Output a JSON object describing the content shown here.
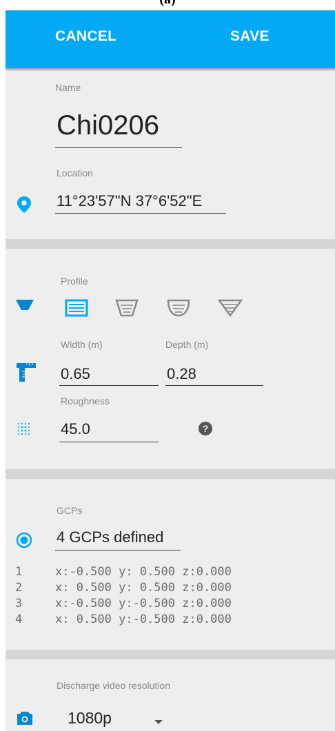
{
  "caption": "(a)",
  "toolbar": {
    "cancel_label": "CANCEL",
    "save_label": "SAVE"
  },
  "site": {
    "name_label": "Name",
    "name_value": "Chi0206",
    "location_label": "Location",
    "location_value": "11°23'57\"N 37°6'52\"E"
  },
  "profile": {
    "label": "Profile",
    "options": [
      "rectangular",
      "trapezoid",
      "rounded",
      "v-shape"
    ],
    "selected": "rectangular",
    "width_label": "Width (m)",
    "width_value": "0.65",
    "depth_label": "Depth (m)",
    "depth_value": "0.28",
    "roughness_label": "Roughness",
    "roughness_value": "45.0"
  },
  "gcps": {
    "label": "GCPs",
    "summary": "4 GCPs defined",
    "rows": [
      {
        "index": "1",
        "coords": "x:-0.500 y: 0.500 z:0.000"
      },
      {
        "index": "2",
        "coords": "x: 0.500 y: 0.500 z:0.000"
      },
      {
        "index": "3",
        "coords": "x:-0.500 y:-0.500 z:0.000"
      },
      {
        "index": "4",
        "coords": "x: 0.500 y:-0.500 z:0.000"
      }
    ]
  },
  "video": {
    "label": "Discharge video resolution",
    "selected": "1080p"
  },
  "colors": {
    "accent": "#03a9f4",
    "card": "#eeeeee",
    "separator": "#d6d6d6"
  },
  "icons": [
    "location-pin-icon",
    "profile-channel-icon",
    "ruler-icon",
    "roughness-dots-icon",
    "help-icon",
    "radio-selected-icon",
    "camera-icon",
    "dropdown-arrow-icon"
  ]
}
